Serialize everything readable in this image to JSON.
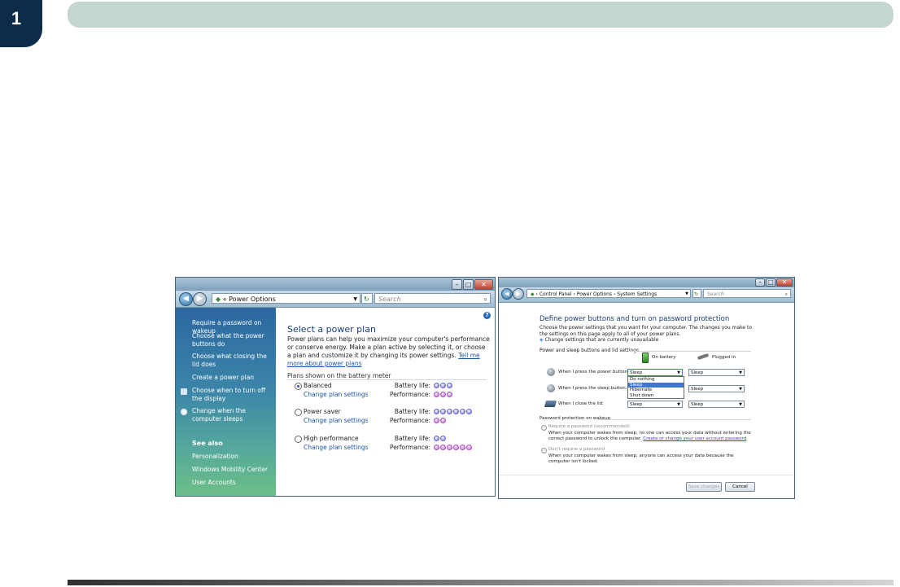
{
  "header": {
    "chapter_number": "1"
  },
  "left_window": {
    "address": "Power Options",
    "search_placeholder": "Search",
    "sidebar": {
      "items": [
        "Require a password on wakeup",
        "Choose what the power buttons do",
        "Choose what closing the lid does",
        "Create a power plan",
        "Choose when to turn off the display",
        "Change when the computer sleeps"
      ],
      "see_also_heading": "See also",
      "see_also": [
        "Personalization",
        "Windows Mobility Center",
        "User Accounts"
      ]
    },
    "main": {
      "title": "Select a power plan",
      "description": "Power plans can help you maximize your computer's performance or conserve energy. Make a plan active by selecting it, or choose a plan and customize it by changing its power settings.",
      "more_link": "Tell me more about power plans",
      "section_label": "Plans shown on the battery meter",
      "change_link": "Change plan settings",
      "battery_label": "Battery life:",
      "performance_label": "Performance:",
      "plans": [
        {
          "name": "Balanced",
          "selected": true,
          "battery": 3,
          "performance": 3
        },
        {
          "name": "Power saver",
          "selected": false,
          "battery": 6,
          "performance": 2
        },
        {
          "name": "High performance",
          "selected": false,
          "battery": 2,
          "performance": 6
        }
      ]
    }
  },
  "right_window": {
    "breadcrumb": [
      "Control Panel",
      "Power Options",
      "System Settings"
    ],
    "search_placeholder": "Search",
    "title": "Define power buttons and turn on password protection",
    "intro": "Choose the power settings that you want for your computer. The changes you make to the settings on this page apply to all of your power plans.",
    "unavailable_link": "Change settings that are currently unavailable",
    "section1": "Power and sleep buttons and lid settings",
    "col_battery": "On battery",
    "col_plugged": "Plugged in",
    "rows": [
      {
        "label": "When I press the power button:",
        "battery": "Sleep",
        "plugged": "Sleep"
      },
      {
        "label": "When I press the sleep button:",
        "battery": "Sleep",
        "plugged": "Sleep"
      },
      {
        "label": "When I close the lid:",
        "battery": "Sleep",
        "plugged": "Sleep"
      }
    ],
    "dropdown_options": [
      "Do nothing",
      "Sleep",
      "Hibernate",
      "Shut down"
    ],
    "dropdown_highlighted": "Sleep",
    "section2": "Password protection on wakeup",
    "require_password": "Require a password (recommended)",
    "require_desc": "When your computer wakes from sleep, no one can access your data without entering the correct password to unlock the computer.",
    "require_link": "Create or change your user account password",
    "no_password": "Don't require a password",
    "no_desc": "When your computer wakes from sleep, anyone can access your data because the computer isn't locked.",
    "save_button": "Save changes",
    "cancel_button": "Cancel"
  }
}
